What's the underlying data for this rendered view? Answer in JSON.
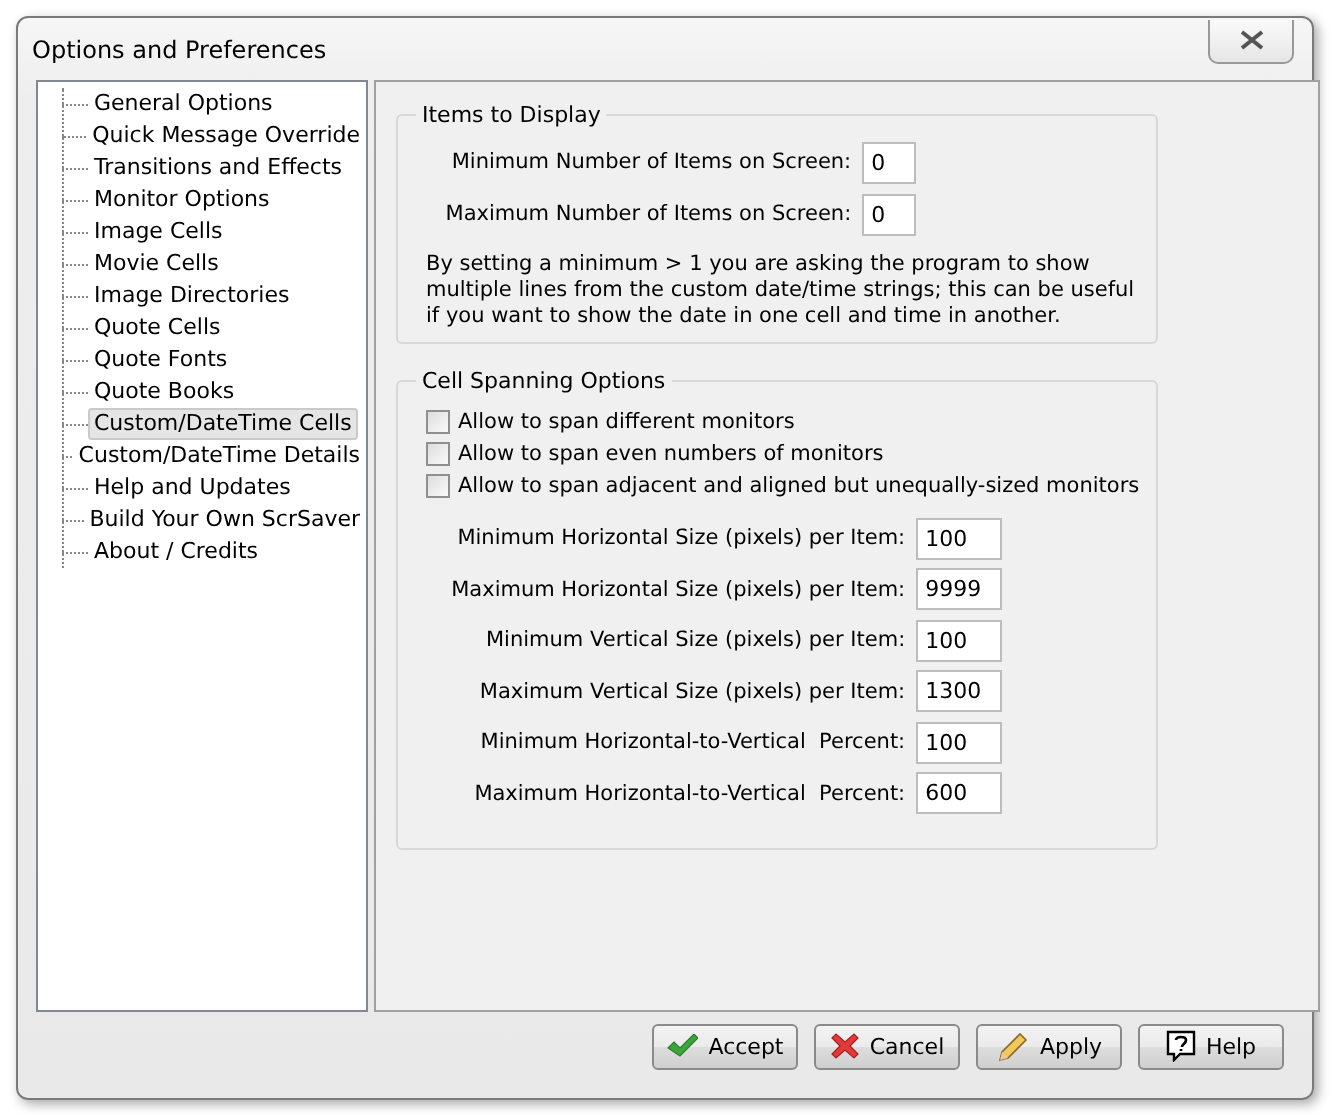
{
  "window": {
    "title": "Options and Preferences"
  },
  "sidebar": {
    "items": [
      {
        "label": "General Options",
        "selected": false
      },
      {
        "label": "Quick Message Override",
        "selected": false
      },
      {
        "label": "Transitions and Effects",
        "selected": false
      },
      {
        "label": "Monitor Options",
        "selected": false
      },
      {
        "label": "Image Cells",
        "selected": false
      },
      {
        "label": "Movie Cells",
        "selected": false
      },
      {
        "label": "Image Directories",
        "selected": false
      },
      {
        "label": "Quote Cells",
        "selected": false
      },
      {
        "label": "Quote Fonts",
        "selected": false
      },
      {
        "label": "Quote Books",
        "selected": false
      },
      {
        "label": "Custom/DateTime Cells",
        "selected": true
      },
      {
        "label": "Custom/DateTime Details",
        "selected": false
      },
      {
        "label": "Help and Updates",
        "selected": false
      },
      {
        "label": "Build Your Own ScrSaver",
        "selected": false
      },
      {
        "label": "About / Credits",
        "selected": false
      }
    ]
  },
  "items_to_display": {
    "title": "Items to Display",
    "fields": [
      {
        "label": "Minimum Number of Items on Screen:",
        "value": "0"
      },
      {
        "label": "Maximum Number of Items on Screen:",
        "value": "0"
      }
    ],
    "note": "By setting a minimum > 1 you are asking the program to show multiple lines from the custom date/time strings; this can be useful if you want to show the date in one cell and time in another."
  },
  "cell_spanning": {
    "title": "Cell Spanning Options",
    "checkboxes": [
      {
        "label": "Allow to span different monitors",
        "checked": false
      },
      {
        "label": "Allow to span even numbers of monitors",
        "checked": false
      },
      {
        "label": "Allow to span adjacent and aligned but unequally-sized monitors",
        "checked": false
      }
    ],
    "fields": [
      {
        "label": "Minimum Horizontal Size (pixels) per Item:",
        "value": "100"
      },
      {
        "label": "Maximum Horizontal Size (pixels) per Item:",
        "value": "9999"
      },
      {
        "label": "Minimum Vertical Size (pixels) per Item:",
        "value": "100"
      },
      {
        "label": "Maximum Vertical Size (pixels) per Item:",
        "value": "1300"
      },
      {
        "label": "Minimum Horizontal-to-Vertical  Percent:",
        "value": "100"
      },
      {
        "label": "Maximum Horizontal-to-Vertical  Percent:",
        "value": "600"
      }
    ]
  },
  "buttons": [
    {
      "label": "Accept",
      "kind": "accept"
    },
    {
      "label": "Cancel",
      "kind": "cancel"
    },
    {
      "label": "Apply",
      "kind": "apply"
    },
    {
      "label": "Help",
      "kind": "help"
    }
  ]
}
